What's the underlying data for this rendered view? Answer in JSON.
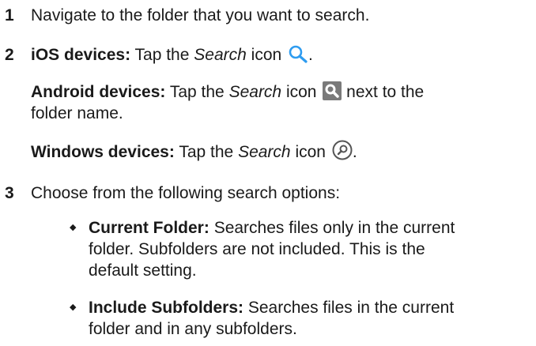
{
  "steps": [
    {
      "number": "1",
      "text": "Navigate to the folder that you want to search."
    },
    {
      "number": "2",
      "ios": {
        "label": "iOS devices:",
        "pre": "Tap the ",
        "em": "Search",
        "post": " icon",
        "tail": ".",
        "icon": "search-magnifier-icon"
      },
      "android": {
        "label": "Android devices:",
        "pre": "Tap the ",
        "em": "Search",
        "post": " icon",
        "after": " next to the",
        "line2": "folder name.",
        "icon": "search-magnifier-icon"
      },
      "windows": {
        "label": "Windows devices:",
        "pre": "Tap the ",
        "em": "Search",
        "post": " icon",
        "tail": ".",
        "icon": "search-circle-icon"
      }
    },
    {
      "number": "3",
      "text": "Choose from the following search options:",
      "options": [
        {
          "label": "Current Folder:",
          "line1": "Searches files only in the current",
          "line2": "folder. Subfolders are not included. This is the",
          "line3": "default setting."
        },
        {
          "label": "Include Subfolders:",
          "line1": "Searches files in the current",
          "line2": "folder and in any subfolders."
        }
      ]
    }
  ],
  "colors": {
    "ios_icon": "#2e9cf0",
    "android_icon_bg": "#7a7a7a",
    "windows_icon": "#555555"
  }
}
